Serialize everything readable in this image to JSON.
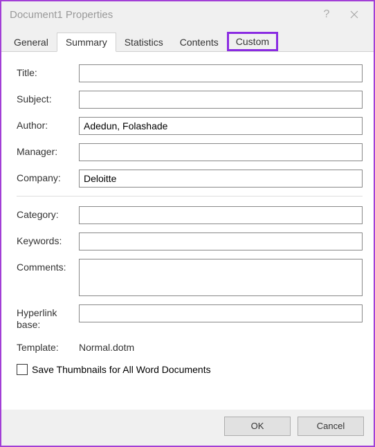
{
  "window": {
    "title": "Document1 Properties"
  },
  "tabs": {
    "general": "General",
    "summary": "Summary",
    "statistics": "Statistics",
    "contents": "Contents",
    "custom": "Custom"
  },
  "form": {
    "title_label": "Title:",
    "title_value": "",
    "subject_label": "Subject:",
    "subject_value": "",
    "author_label": "Author:",
    "author_value": "Adedun, Folashade",
    "manager_label": "Manager:",
    "manager_value": "",
    "company_label": "Company:",
    "company_value": "Deloitte",
    "category_label": "Category:",
    "category_value": "",
    "keywords_label": "Keywords:",
    "keywords_value": "",
    "comments_label": "Comments:",
    "comments_value": "",
    "hyperlink_label": "Hyperlink base:",
    "hyperlink_value": "",
    "template_label": "Template:",
    "template_value": "Normal.dotm",
    "save_thumbnails_label": "Save Thumbnails for All Word Documents"
  },
  "buttons": {
    "ok": "OK",
    "cancel": "Cancel"
  }
}
